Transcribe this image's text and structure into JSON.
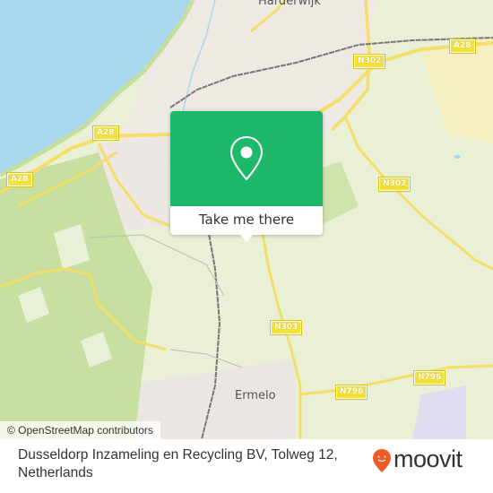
{
  "map": {
    "places": [
      {
        "name": "Harderwijk",
        "label": "Harderwijk"
      },
      {
        "name": "Ermelo",
        "label": "Ermelo"
      }
    ],
    "road_shields": [
      {
        "ref": "A28"
      },
      {
        "ref": "A28"
      },
      {
        "ref": "A28"
      },
      {
        "ref": "N302"
      },
      {
        "ref": "N302"
      },
      {
        "ref": "N303"
      },
      {
        "ref": "N796"
      },
      {
        "ref": "N796"
      }
    ],
    "attribution": "© OpenStreetMap contributors",
    "colors": {
      "water": "#a7d8ee",
      "urban": "#efe9e4",
      "forest": "#c9e0a5",
      "road_major": "#f4de6a",
      "rail": "#777777"
    }
  },
  "popup": {
    "icon": "map-pin-icon",
    "button_label": "Take me there",
    "color": "#1db86a"
  },
  "footer": {
    "address_line1": "Dusseldorp Inzameling en Recycling BV, Tolweg 12,",
    "address_line2": "Netherlands",
    "brand": "moovit",
    "brand_color": "#f05a28"
  }
}
